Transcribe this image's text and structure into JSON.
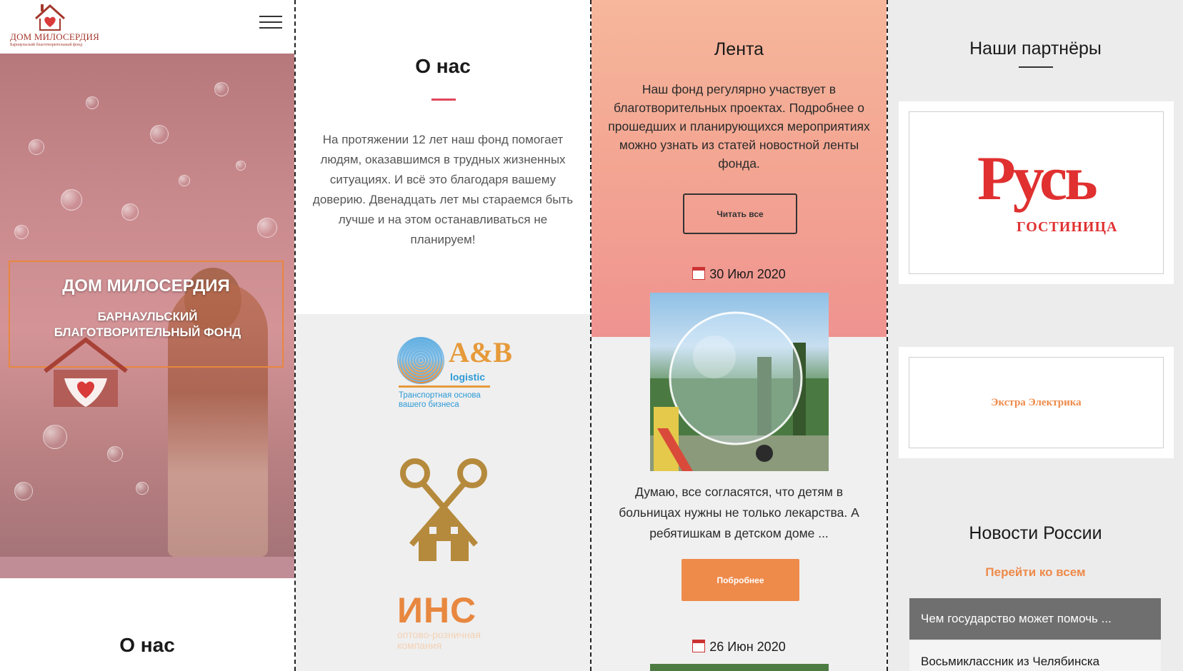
{
  "brand": {
    "logo_title": "ДОМ МИЛОСЕРДИЯ",
    "logo_subtitle": "Барнаульский благотворительный фонд"
  },
  "hero": {
    "title": "ДОМ МИЛОСЕРДИЯ",
    "subtitle": "БАРНАУЛЬСКИЙ БЛАГОТВОРИТЕЛЬНЫЙ ФОНД"
  },
  "panel1": {
    "section_title": "О нас"
  },
  "about": {
    "title": "О нас",
    "text": "На протяжении 12 лет наш фонд помогает людям, оказавшимся в трудных жизненных ситуациях. И всё это благодаря вашему доверию. Двенадцать лет мы стараемся быть лучше и на этом останавливаться не планируем!"
  },
  "partner_logos": {
    "ab_name": "A&B",
    "ab_sub": "logistic",
    "ab_tagline": "Транспортная основа вашего бизнеса",
    "ins_name": "ИНС",
    "ins_tagline": "оптово-розничная компания"
  },
  "feed": {
    "title": "Лента",
    "text": "Наш фонд регулярно участвует в благотворительных проектах. Подробнее о прошедших и планирующихся мероприятиях можно узнать из статей новостной ленты фонда.",
    "read_all": "Читать все",
    "posts": [
      {
        "date": "30 Июл 2020",
        "excerpt": "Думаю, все согласятся, что детям в больницах нужны не только лекарства. А ребятишкам в детском доме ...",
        "more": "Побробнее"
      },
      {
        "date": "26 Июн 2020"
      }
    ]
  },
  "partners": {
    "title": "Наши партнёры",
    "items": [
      {
        "name": "Русь",
        "sub": "ГОСТИНИЦА"
      },
      {
        "name": "Экстра Электрика"
      }
    ]
  },
  "russia_news": {
    "title": "Новости России",
    "link": "Перейти ко всем",
    "items": [
      "Чем государство может помочь ...",
      "Восьмиклассник из Челябинска"
    ]
  },
  "colors": {
    "accent_orange": "#ee8a4a",
    "accent_red": "#e0475a",
    "brand_red": "#a3382c"
  }
}
